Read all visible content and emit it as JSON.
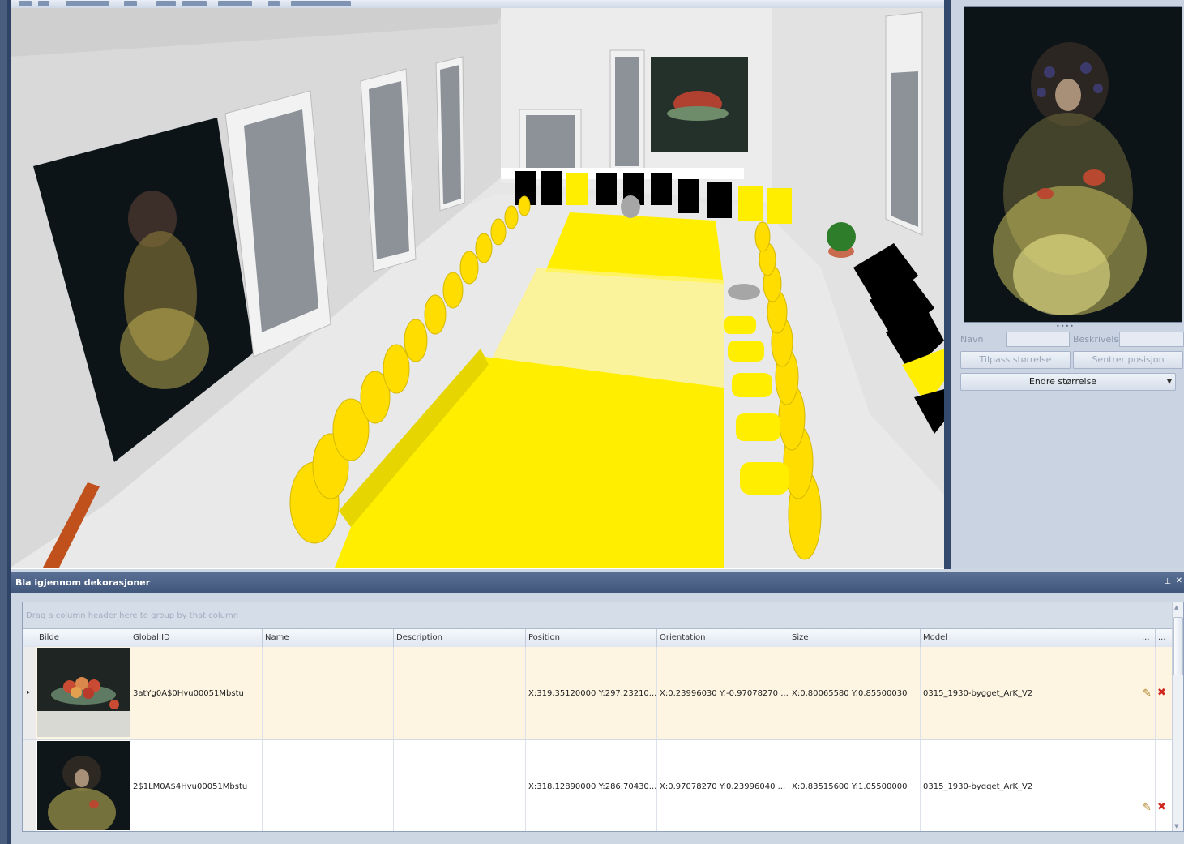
{
  "preview": {
    "name_label": "Navn",
    "description_label": "Beskrivelse",
    "fit_size_button": "Tilpass størrelse",
    "center_position_button": "Sentrer posisjon",
    "resize_button": "Endre størrelse"
  },
  "dock": {
    "title": "Bla igjennom dekorasjoner",
    "pin_glyph": "ᷮ",
    "close_glyph": "×"
  },
  "grid": {
    "group_hint": "Drag a column header here to group by that column",
    "columns": [
      "Bilde",
      "Global ID",
      "Name",
      "Description",
      "Position",
      "Orientation",
      "Size",
      "Model",
      "...",
      "..."
    ],
    "rows": [
      {
        "global_id": "3atYg0A$0Hvu00051Mbstu",
        "name": "",
        "description": "",
        "position": "X:319.35120000 Y:297.23210...",
        "orientation": "X:0.23996030 Y:-0.97078270 ...",
        "size": "X:0.80065580 Y:0.85500030",
        "model": "0315_1930-bygget_ArK_V2",
        "thumbnail": "fruit-bowl-painting",
        "selected": true
      },
      {
        "global_id": "2$1LM0A$4Hvu00051Mbstu",
        "name": "",
        "description": "",
        "position": "X:318.12890000 Y:286.70430...",
        "orientation": "X:0.97078270 Y:0.23996040 ...",
        "size": "X:0.83515600 Y:1.05500000",
        "model": "0315_1930-bygget_ArK_V2",
        "thumbnail": "infanta-portrait-painting",
        "selected": false
      }
    ]
  },
  "icons": {
    "row_indicator": "▸",
    "edit": "edit-pencil-icon",
    "delete": "delete-x-icon"
  },
  "colors": {
    "furniture_yellow": "#ffee00",
    "panel_bg": "#cad3e1",
    "header_blue": "#3f5579",
    "selected_row": "#fdf5e2"
  }
}
